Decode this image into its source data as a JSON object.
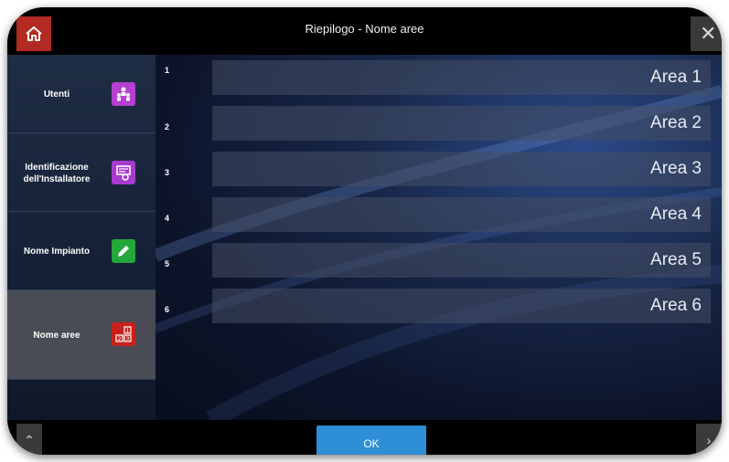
{
  "header": {
    "title": "Riepilogo - Nome aree",
    "home_icon": "home-icon",
    "close_icon": "close-icon"
  },
  "sidebar": {
    "items": [
      {
        "label": "Utenti",
        "icon": "users-icon",
        "color": "#b53fd0",
        "active": false
      },
      {
        "label": "Identificazione dell'Installatore",
        "icon": "installer-id-icon",
        "color": "#a83ad0",
        "active": false
      },
      {
        "label": "Nome Impianto",
        "icon": "pencil-icon",
        "color": "#23a83a",
        "active": false
      },
      {
        "label": "Nome aree",
        "icon": "areas-icon",
        "color": "#c8201a",
        "active": true
      }
    ],
    "up_icon": "chevron-up-icon",
    "down_icon": "chevron-down-icon"
  },
  "areas": [
    {
      "number": "1",
      "name": "Area 1"
    },
    {
      "number": "2",
      "name": "Area 2"
    },
    {
      "number": "3",
      "name": "Area 3"
    },
    {
      "number": "4",
      "name": "Area 4"
    },
    {
      "number": "5",
      "name": "Area 5"
    },
    {
      "number": "6",
      "name": "Area 6"
    }
  ],
  "footer": {
    "ok_label": "OK"
  },
  "colors": {
    "accent_red": "#b0140f",
    "ok_blue": "#2f8fd6",
    "active_item": "#4a4c55"
  }
}
